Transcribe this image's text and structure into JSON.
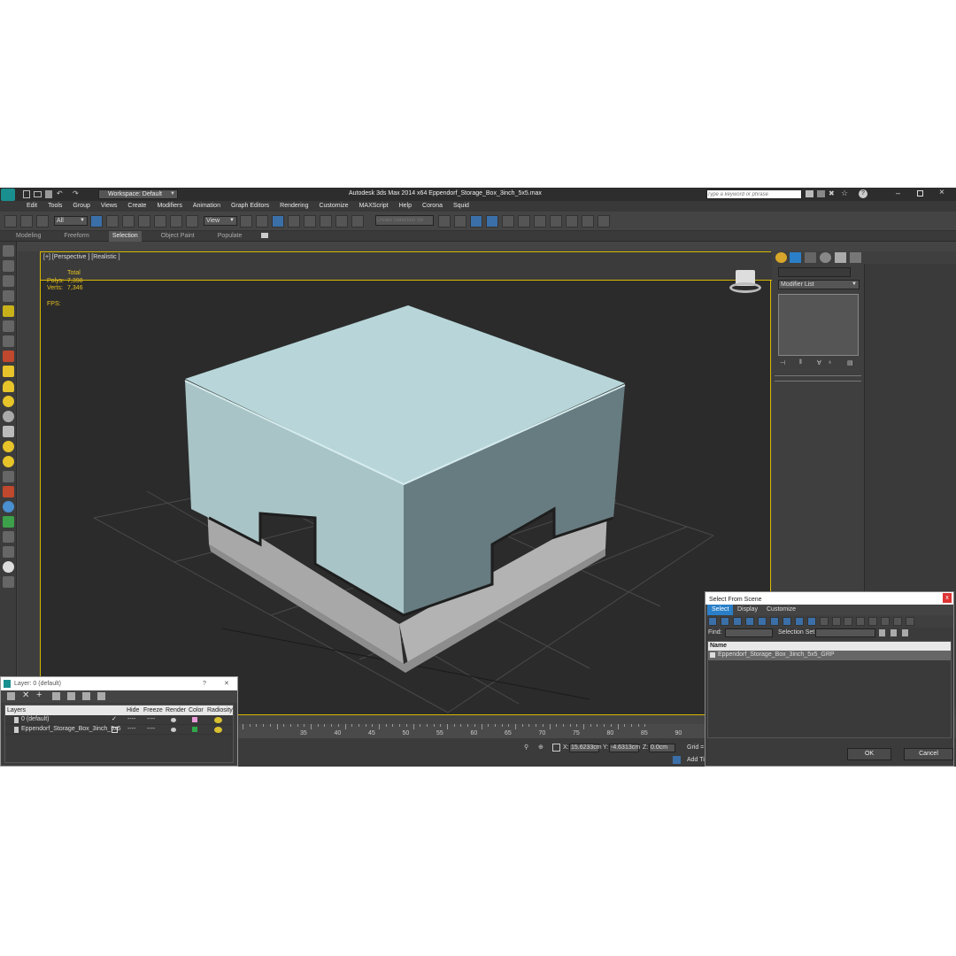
{
  "app": {
    "title": "Autodesk 3ds Max  2014 x64    Eppendorf_Storage_Box_3inch_5x5.max",
    "workspace": "Workspace: Default",
    "search_placeholder": "Type a keyword or phrase"
  },
  "menu": [
    "Edit",
    "Tools",
    "Group",
    "Views",
    "Create",
    "Modifiers",
    "Animation",
    "Graph Editors",
    "Rendering",
    "Customize",
    "MAXScript",
    "Help",
    "Corona",
    "Squid"
  ],
  "toolbar": {
    "filter_value": "All",
    "refcoord_value": "View",
    "selection_set_placeholder": "Create Selection Se"
  },
  "ribbon": {
    "tabs": [
      "Modeling",
      "Freeform",
      "Selection",
      "Object Paint",
      "Populate"
    ],
    "active": "Selection"
  },
  "viewport": {
    "label": "[+] [Perspective ] [Realistic ]",
    "stats_header": "Total",
    "polys_label": "Polys:",
    "polys_value": "7,398",
    "verts_label": "Verts:",
    "verts_value": "7,346",
    "fps_label": "FPS:"
  },
  "command_panel": {
    "modifier_list": "Modifier List"
  },
  "timeline": {
    "ticks": [
      "35",
      "40",
      "45",
      "50",
      "55",
      "60",
      "65",
      "70",
      "75",
      "80",
      "85",
      "90"
    ]
  },
  "status": {
    "x_label": "X:",
    "x_value": "15.6233cm",
    "y_label": "Y:",
    "y_value": "-4.6313cm",
    "z_label": "Z:",
    "z_value": "0.0cm",
    "grid_label": "Grid =",
    "add_time_tag": "Add Ti"
  },
  "layer_dialog": {
    "title": "Layer: 0 (default)",
    "help": "?",
    "close": "✕",
    "columns": [
      "Layers",
      "Hide",
      "Freeze",
      "Render",
      "Color",
      "Radiosity"
    ],
    "rows": [
      {
        "name": "0 (default)",
        "hide": "----",
        "freeze": "----",
        "color": "#e79ad6"
      },
      {
        "name": "Eppendorf_Storage_Box_3inch_5x5",
        "hide": "----",
        "freeze": "----",
        "color": "#2fa84a"
      }
    ]
  },
  "select_dialog": {
    "title": "Select From Scene",
    "close": "x",
    "tabs": [
      "Select",
      "Display",
      "Customize"
    ],
    "find_label": "Find:",
    "selection_set_label": "Selection Set:",
    "column_name": "Name",
    "items": [
      "Eppendorf_Storage_Box_3inch_5x5_GRP"
    ],
    "ok": "OK",
    "cancel": "Cancel"
  },
  "colors": {
    "box_top": "#b8d6d9",
    "box_side_light": "#a9c4c7",
    "box_side_dark": "#677c81",
    "base": "#a9a9a9",
    "viewport_bg": "#2b2b2b",
    "accent_yellow": "#d8b800",
    "accent_blue": "#2a7fc8"
  }
}
